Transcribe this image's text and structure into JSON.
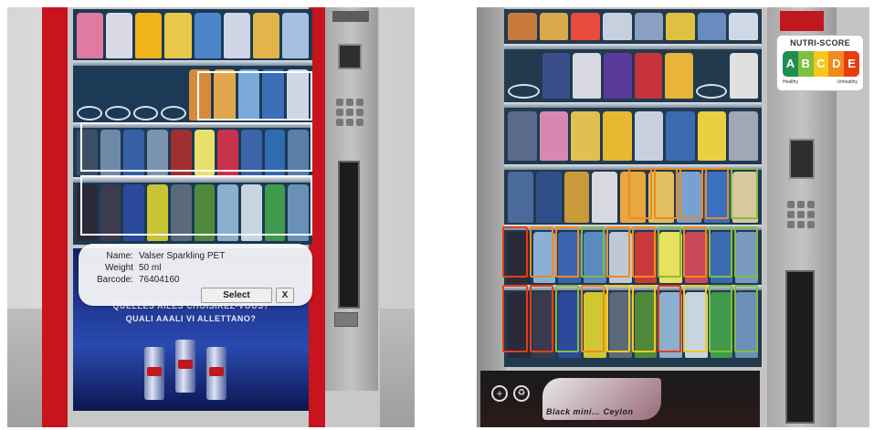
{
  "left_view": {
    "product_info": {
      "name_label": "Name:",
      "name_value": "Valser Sparkling PET",
      "weight_label": "Weight",
      "weight_value": "50 ml",
      "barcode_label": "Barcode:",
      "barcode_value": "76404160"
    },
    "buttons": {
      "select_label": "Select",
      "close_label": "X"
    },
    "ad_lines": [
      "QUELLES AILES CHOISIREZ-VOUS?",
      "QUALI AAALI VI ALLETTANO?"
    ]
  },
  "right_view": {
    "nutri_score": {
      "title": "NUTRI-SCORE",
      "grades": [
        {
          "letter": "A",
          "color": "#1e8f4e"
        },
        {
          "letter": "B",
          "color": "#7fbf3f"
        },
        {
          "letter": "C",
          "color": "#f4c81c"
        },
        {
          "letter": "D",
          "color": "#f08a1c"
        },
        {
          "letter": "E",
          "color": "#e63e11"
        }
      ],
      "low_label": "Healthy",
      "high_label": "Unhealthy"
    },
    "ad_text": "Black mini… Ceylon"
  },
  "colors": {
    "selection_outline": "#ffffff",
    "machine_red": "#c8141c",
    "popup_bg": "#fafafa"
  },
  "icons": [
    "plus-icon",
    "recycle-icon"
  ]
}
